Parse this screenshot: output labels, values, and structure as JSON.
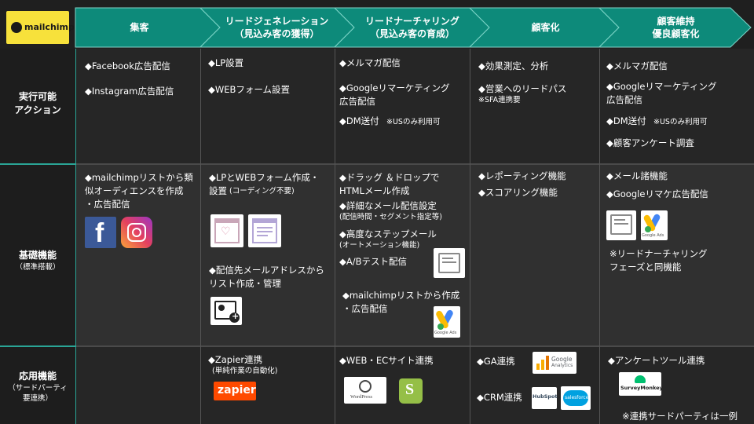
{
  "brand": {
    "logo_text": "mailchimp"
  },
  "colors": {
    "header_teal": "#0d8a7a",
    "header_edge": "#7fd6c9",
    "dark_row": "#262626",
    "mid_row": "#303030"
  },
  "phases": [
    {
      "line1": "集客",
      "line2": ""
    },
    {
      "line1": "リードジェネレーション",
      "line2": "（見込み客の獲得）"
    },
    {
      "line1": "リードナーチャリング",
      "line2": "（見込み客の育成）"
    },
    {
      "line1": "顧客化",
      "line2": ""
    },
    {
      "line1": "顧客維持",
      "line2": "優良顧客化"
    }
  ],
  "rows": {
    "action": {
      "label_line1": "実行可能",
      "label_line2": "アクション"
    },
    "basic": {
      "label": "基礎機能",
      "sub": "（標準搭載）"
    },
    "advanced": {
      "label": "応用機能",
      "sub1": "（サードパーティ",
      "sub2": "要連携）"
    }
  },
  "action": {
    "c1": [
      "◆Facebook広告配信",
      "◆Instagram広告配信"
    ],
    "c2": [
      "◆LP設置",
      "◆WEBフォーム設置"
    ],
    "c3": {
      "item1": "◆メルマガ配信",
      "item2a": "◆Googleリマーケティング",
      "item2b": "広告配信",
      "item3": "◆DM送付",
      "item3_note": "※USのみ利用可"
    },
    "c4": {
      "item1": "◆効果測定、分析",
      "item2": "◆営業へのリードパス",
      "item2_note": "※SFA連携要"
    },
    "c5": {
      "item1": "◆メルマガ配信",
      "item2a": "◆Googleリマーケティング",
      "item2b": "広告配信",
      "item3": "◆DM送付",
      "item3_note": "※USのみ利用可",
      "item4": "◆顧客アンケート調査"
    }
  },
  "basic": {
    "c1": {
      "l1": "◆mailchimpリストから類",
      "l2": "似オーディエンスを作成",
      "l3": "・広告配信"
    },
    "c2": {
      "a1": "◆LPとWEBフォーム作成・",
      "a2": "設置",
      "a2_note": "(コーディング不要)",
      "b1": "◆配信先メールアドレスから",
      "b2": "リスト作成・管理"
    },
    "c3": {
      "a1": "◆ドラッグ ＆ドロップで",
      "a2": "HTMLメール作成",
      "b1": "◆詳細なメール配信設定",
      "b2": "(配信時間・セグメント指定等)",
      "c1": "◆高度なステップメール",
      "c2": "(オートメーション機能)",
      "d1": "◆A/Bテスト配信",
      "e1": "◆mailchimpリストから作成",
      "e2": "・広告配信",
      "ads_caption": "Google Ads"
    },
    "c4": [
      "◆レポーティング機能",
      "◆スコアリング機能"
    ],
    "c5": {
      "a1": "◆メール諸機能",
      "b1": "◆Googleリマケ広告配信",
      "ads_caption": "Google Ads",
      "note1": "※リードナーチャリング",
      "note2": "フェーズと同機能"
    }
  },
  "advanced": {
    "c2": {
      "l1": "◆Zapier連携",
      "l2": "(単純作業の自動化)",
      "logo": "zapier"
    },
    "c3": {
      "l1": "◆WEB・ECサイト連携",
      "wp_text": "WordPress"
    },
    "c4": {
      "ga": "◆GA連携",
      "crm": "◆CRM連携",
      "ga_logo1": "Google",
      "ga_logo2": "Analytics",
      "hubspot": "HubSpot",
      "salesforce": "salesforce"
    },
    "c5": {
      "l1": "◆アンケートツール連携",
      "sm_logo": "SurveyMonkey",
      "note": "※連携サードパーティは一例"
    }
  }
}
